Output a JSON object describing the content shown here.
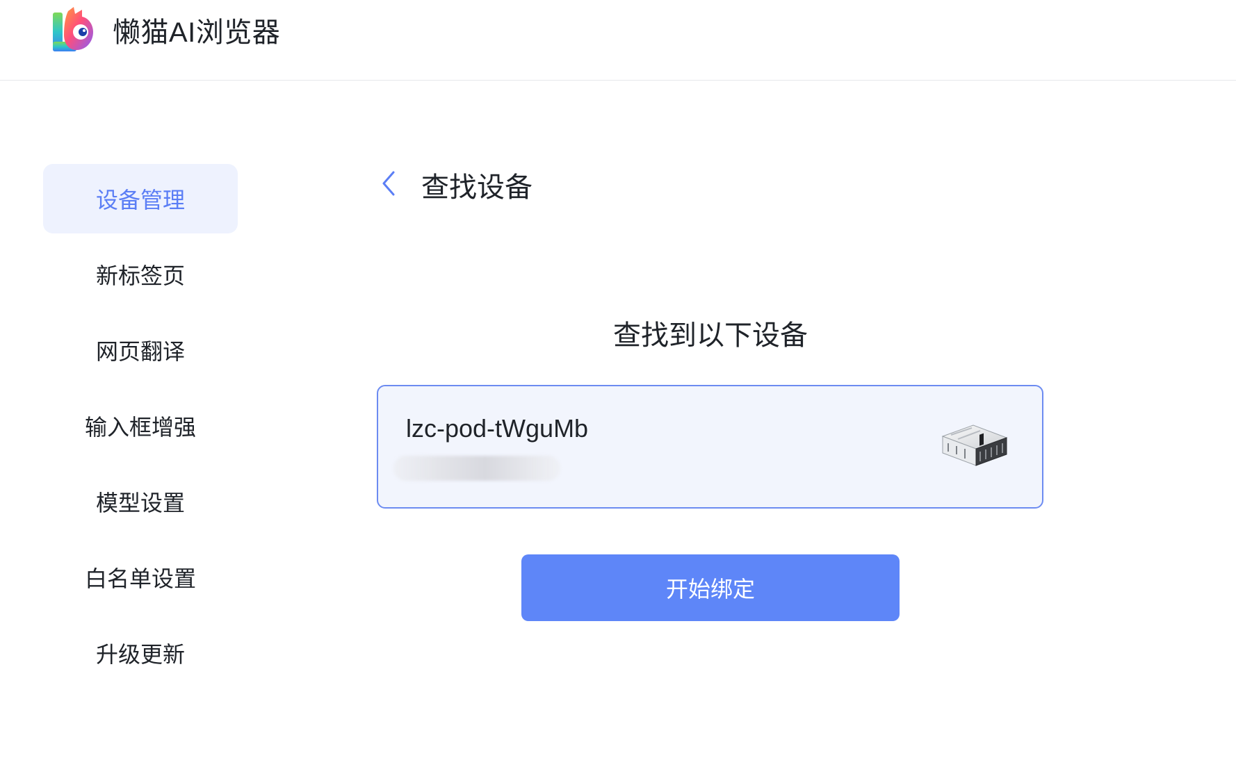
{
  "header": {
    "app_title": "懒猫AI浏览器",
    "logo_icon": "lazycat-logo-icon"
  },
  "sidebar": {
    "items": [
      {
        "label": "设备管理",
        "active": true
      },
      {
        "label": "新标签页",
        "active": false
      },
      {
        "label": "网页翻译",
        "active": false
      },
      {
        "label": "输入框增强",
        "active": false
      },
      {
        "label": "模型设置",
        "active": false
      },
      {
        "label": "白名单设置",
        "active": false
      },
      {
        "label": "升级更新",
        "active": false
      }
    ]
  },
  "main": {
    "back_icon": "chevron-left-icon",
    "page_title": "查找设备",
    "found_heading": "查找到以下设备",
    "device": {
      "name": "lzc-pod-tWguMb",
      "image_icon": "device-hardware-icon"
    },
    "bind_button_label": "开始绑定"
  },
  "colors": {
    "accent": "#5e86f8",
    "active_bg": "#eef2fe",
    "active_text": "#5b7ef5",
    "card_border": "#6c8bf1",
    "card_bg": "#f2f5fd"
  }
}
